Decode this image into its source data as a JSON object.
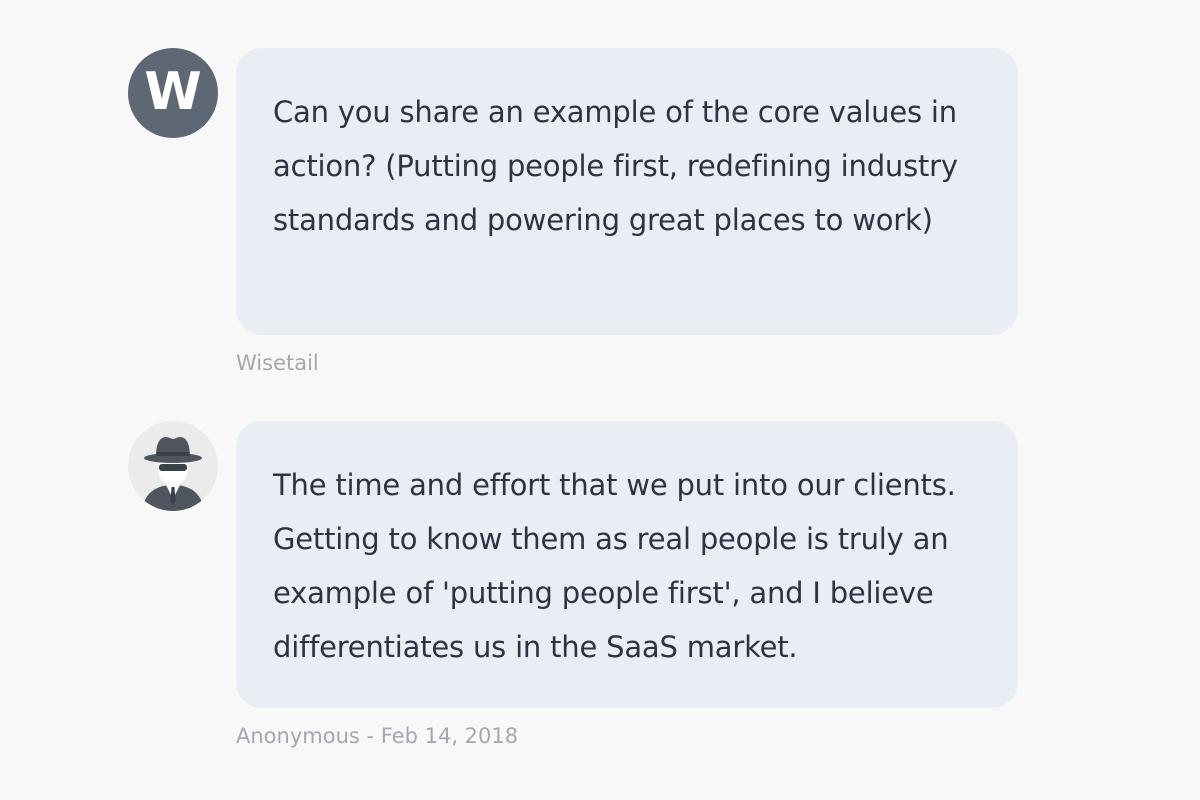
{
  "thread": {
    "messages": [
      {
        "avatar": {
          "type": "letter",
          "letter": "W",
          "color": "#5e6875"
        },
        "text": "Can you share an example of the core values in action? (Putting people first, redefining industry standards and powering great places to work)",
        "meta": "Wisetail"
      },
      {
        "avatar": {
          "type": "anonymous-spy-icon",
          "color": "#4f565f"
        },
        "text": "The time and effort that we put into our clients. Getting to know them as real people is truly an example of 'putting people first', and I believe differentiates us in the SaaS market.",
        "meta": "Anonymous - Feb 14, 2018"
      }
    ]
  },
  "colors": {
    "background": "#f8f8f8",
    "bubble": "#e9edf4",
    "text": "#2c3441",
    "meta_text": "#a3a8ae"
  }
}
